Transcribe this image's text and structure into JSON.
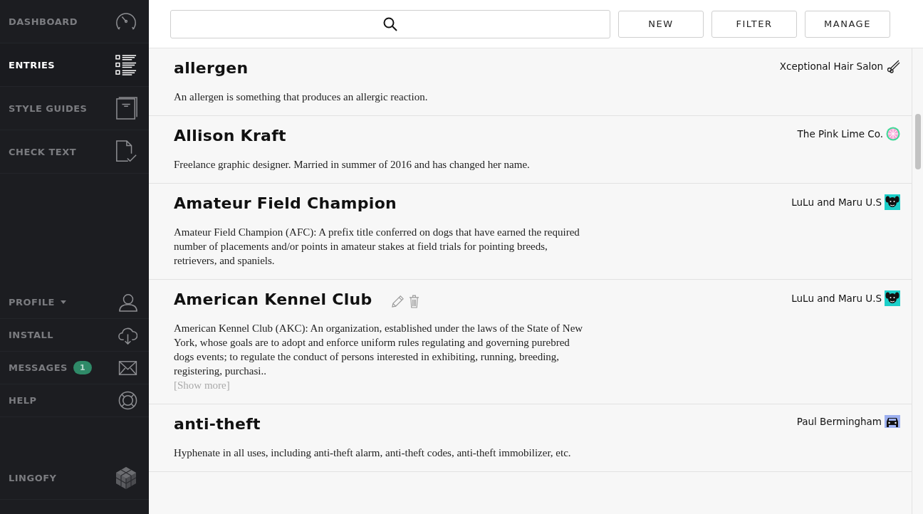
{
  "sidebar": {
    "top_items": [
      {
        "label": "DASHBOARD",
        "selected": false
      },
      {
        "label": "ENTRIES",
        "selected": true
      },
      {
        "label": "STYLE GUIDES",
        "selected": false
      },
      {
        "label": "CHECK TEXT",
        "selected": false
      }
    ],
    "bottom_items": [
      {
        "label": "PROFILE",
        "selected": false,
        "has_menu": true
      },
      {
        "label": "INSTALL",
        "selected": false,
        "has_menu": false
      },
      {
        "label": "MESSAGES",
        "selected": false,
        "has_menu": false,
        "badge": "1"
      },
      {
        "label": "HELP",
        "selected": false,
        "has_menu": false
      }
    ],
    "brand": {
      "label": "LINGOFY"
    }
  },
  "toolbar": {
    "buttons": [
      "NEW",
      "FILTER",
      "MANAGE"
    ]
  },
  "entries": [
    {
      "title": "allergen",
      "description": "An allergen is something that produces an allergic reaction.",
      "owner": "Xceptional Hair Salon",
      "show_actions": false
    },
    {
      "title": "Allison Kraft",
      "description": "Freelance graphic designer. Married in summer of 2016 and has changed her name.",
      "owner": "The Pink Lime Co.",
      "show_actions": false
    },
    {
      "title": "Amateur Field Champion",
      "description": "Amateur Field Champion (AFC): A prefix title conferred on dogs that have earned the required number of placements and/or points in amateur stakes at field trials for pointing breeds, retrievers, and spaniels.",
      "owner": "LuLu and Maru U.S",
      "show_actions": false
    },
    {
      "title": "American Kennel Club",
      "description": "American Kennel Club (AKC): An organization, established under the laws of the State of New York, whose goals are to adopt and enforce uniform rules regulating and governing purebred dogs events; to regulate the conduct of persons interested in exhibiting, running, breeding, registering, purchasi..",
      "show_more": "[Show more]",
      "owner": "LuLu and Maru U.S",
      "show_actions": true
    },
    {
      "title": "anti-theft",
      "description": "Hyphenate in all uses, including anti-theft alarm, anti-theft codes, anti-theft immobilizer, etc.",
      "owner": "Paul Bermingham",
      "show_actions": false
    }
  ]
}
